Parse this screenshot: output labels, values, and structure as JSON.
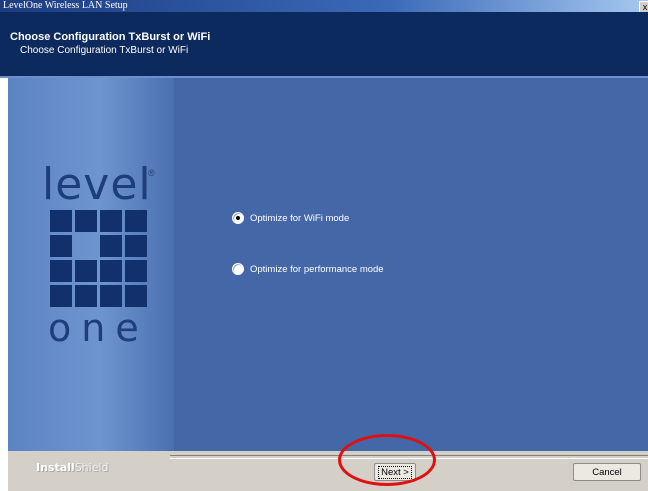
{
  "window": {
    "title": "LevelOne Wireless LAN Setup",
    "close_glyph": "x"
  },
  "header": {
    "title": "Choose Configuration TxBurst or WiFi",
    "subtitle": "Choose Configuration TxBurst or WiFi"
  },
  "logo": {
    "top_word": "level",
    "registered_mark": "®",
    "bottom_word": "one"
  },
  "options": [
    {
      "label": "Optimize for WiFi mode",
      "selected": true
    },
    {
      "label": "Optimize for performance mode",
      "selected": false
    }
  ],
  "footer": {
    "brand_bold": "Install",
    "brand_light": "Shield",
    "next_label": "Next >",
    "cancel_label": "Cancel"
  },
  "colors": {
    "header_bg": "#0c2a5e",
    "panel_bg": "#4467a8",
    "highlight": "#e01010"
  },
  "icons": {
    "radio_selected": "radio-selected-icon",
    "radio_unselected": "radio-unselected-icon"
  }
}
